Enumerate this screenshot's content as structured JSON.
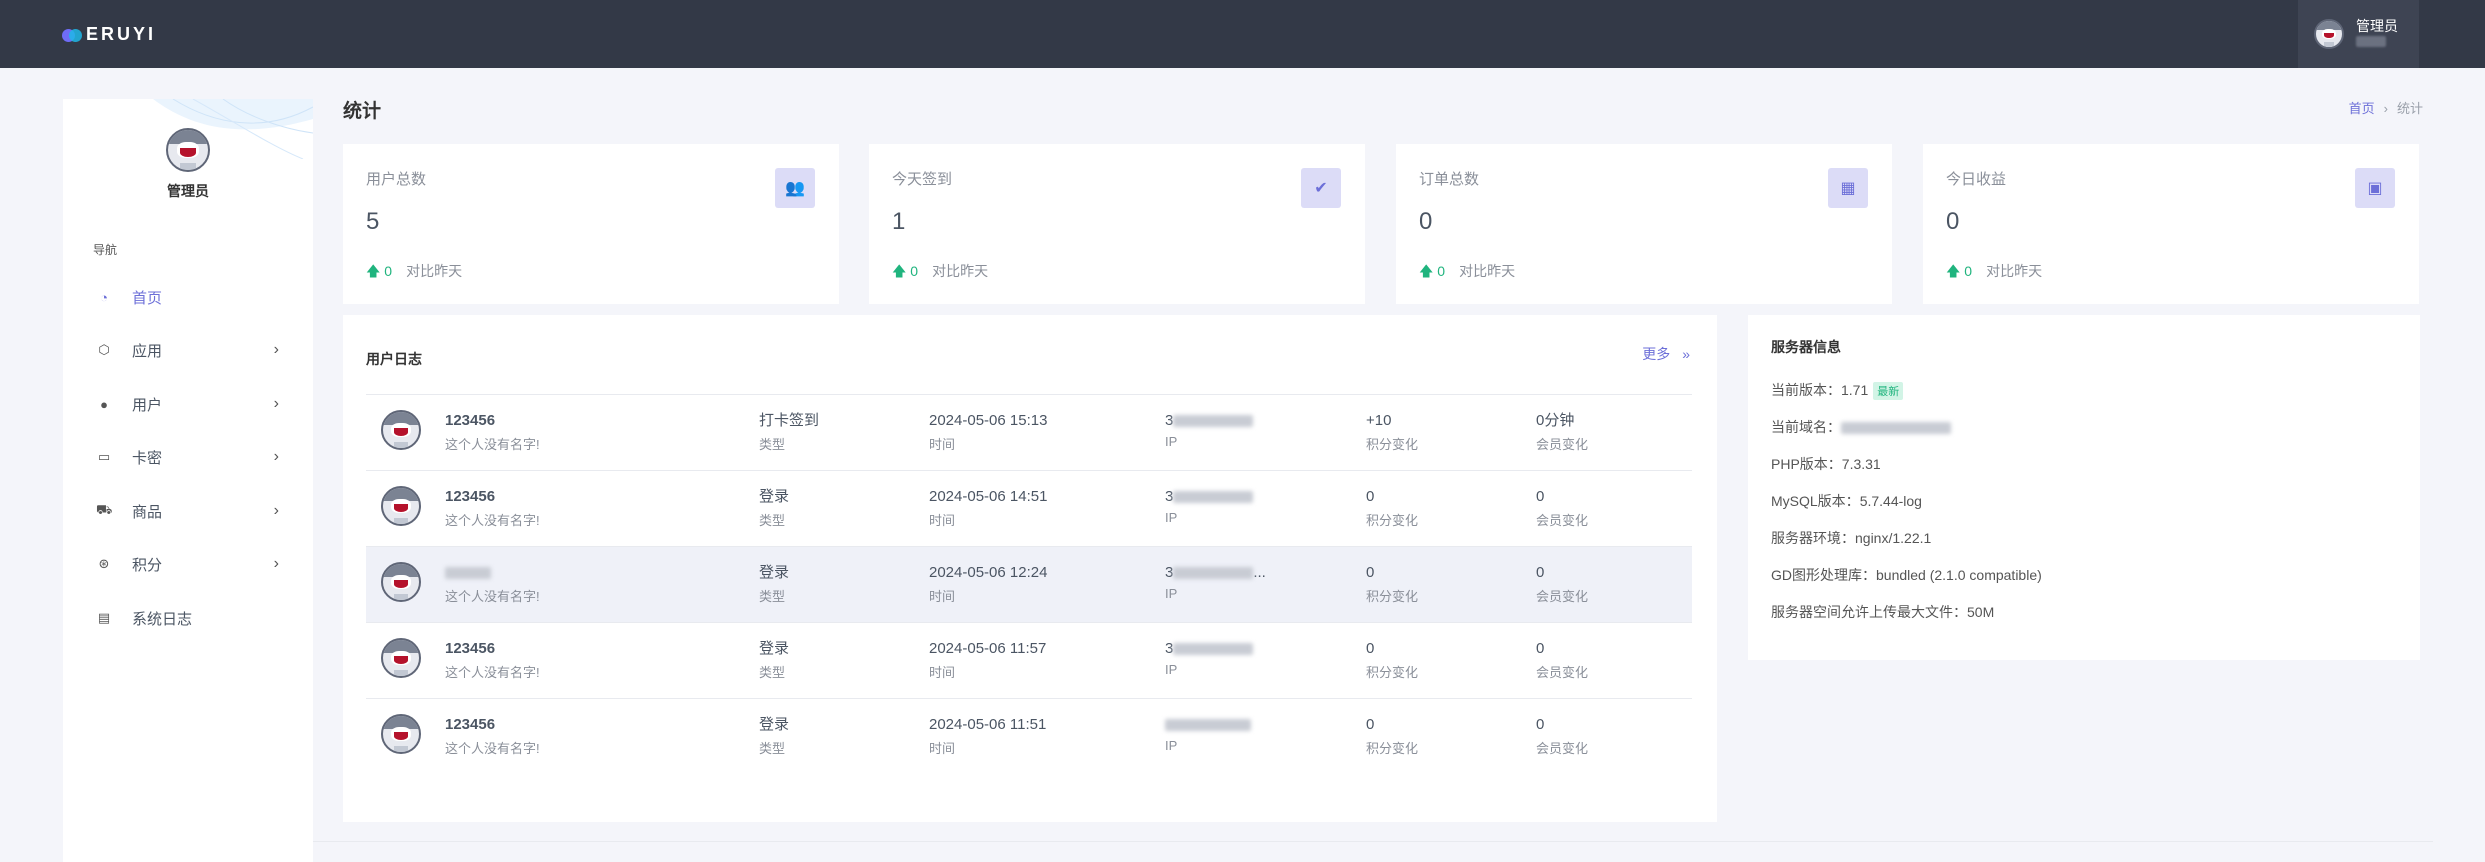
{
  "topbar": {
    "logo_text": "ERUYI",
    "user_name": "管理员"
  },
  "sidebar": {
    "user_name": "管理员",
    "nav_title": "导航",
    "items": [
      {
        "label": "首页",
        "icon": "dashboard-icon",
        "active": true,
        "has_children": false
      },
      {
        "label": "应用",
        "icon": "cube-icon",
        "active": false,
        "has_children": true
      },
      {
        "label": "用户",
        "icon": "user-icon",
        "active": false,
        "has_children": true
      },
      {
        "label": "卡密",
        "icon": "card-icon",
        "active": false,
        "has_children": true
      },
      {
        "label": "商品",
        "icon": "cart-icon",
        "active": false,
        "has_children": true
      },
      {
        "label": "积分",
        "icon": "coin-icon",
        "active": false,
        "has_children": true
      },
      {
        "label": "系统日志",
        "icon": "log-icon",
        "active": false,
        "has_children": false
      }
    ]
  },
  "page": {
    "title": "统计",
    "breadcrumb": [
      "首页",
      "统计"
    ],
    "breadcrumb_sep": "›"
  },
  "stats": [
    {
      "label": "用户总数",
      "value": "5",
      "change": "0",
      "compare": "对比昨天",
      "icon": "users-icon"
    },
    {
      "label": "今天签到",
      "value": "1",
      "change": "0",
      "compare": "对比昨天",
      "icon": "user-check-icon"
    },
    {
      "label": "订单总数",
      "value": "0",
      "change": "0",
      "compare": "对比昨天",
      "icon": "calendar-icon"
    },
    {
      "label": "今日收益",
      "value": "0",
      "change": "0",
      "compare": "对比昨天",
      "icon": "money-icon"
    }
  ],
  "user_log": {
    "title": "用户日志",
    "more_label": "更多",
    "more_arrow": "»",
    "sub_labels": {
      "type": "类型",
      "time": "时间",
      "ip": "IP",
      "points": "积分变化",
      "member": "会员变化"
    },
    "rows": [
      {
        "name": "123456",
        "bio": "这个人没有名字!",
        "type": "打卡签到",
        "time": "2024-05-06 15:13",
        "ip_prefix": "3",
        "ip_suffix": "",
        "points": "+10",
        "member": "0分钟",
        "highlight": false,
        "name_hidden": false
      },
      {
        "name": "123456",
        "bio": "这个人没有名字!",
        "type": "登录",
        "time": "2024-05-06 14:51",
        "ip_prefix": "3",
        "ip_suffix": "",
        "points": "0",
        "member": "0",
        "highlight": false,
        "name_hidden": false
      },
      {
        "name": "",
        "bio": "这个人没有名字!",
        "type": "登录",
        "time": "2024-05-06 12:24",
        "ip_prefix": "3",
        "ip_suffix": "...",
        "points": "0",
        "member": "0",
        "highlight": true,
        "name_hidden": true
      },
      {
        "name": "123456",
        "bio": "这个人没有名字!",
        "type": "登录",
        "time": "2024-05-06 11:57",
        "ip_prefix": "3",
        "ip_suffix": "",
        "points": "0",
        "member": "0",
        "highlight": false,
        "name_hidden": false
      },
      {
        "name": "123456",
        "bio": "这个人没有名字!",
        "type": "登录",
        "time": "2024-05-06 11:51",
        "ip_prefix": "",
        "ip_suffix": "",
        "points": "0",
        "member": "0",
        "highlight": false,
        "name_hidden": false
      }
    ]
  },
  "server_info": {
    "title": "服务器信息",
    "rows": [
      {
        "label": "当前版本：",
        "value": "1.71",
        "badge": "最新"
      },
      {
        "label": "当前域名：",
        "value": "",
        "badge": ""
      },
      {
        "label": "PHP版本：",
        "value": "7.3.31",
        "badge": ""
      },
      {
        "label": "MySQL版本：",
        "value": "5.7.44-log",
        "badge": ""
      },
      {
        "label": "服务器环境：",
        "value": "nginx/1.22.1",
        "badge": ""
      },
      {
        "label": "GD图形处理库：",
        "value": "bundled (2.1.0 compatible)",
        "badge": ""
      },
      {
        "label": "服务器空间允许上传最大文件：",
        "value": "50M",
        "badge": ""
      }
    ]
  },
  "colors": {
    "accent": "#6c6fd8",
    "topbar": "#333947",
    "positive": "#20b47e",
    "background": "#f4f5fa"
  }
}
